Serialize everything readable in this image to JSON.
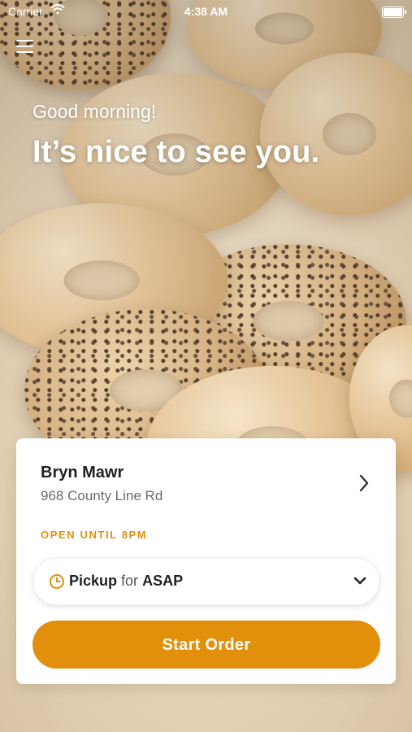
{
  "status_bar": {
    "carrier": "Carrier",
    "time": "4:38 AM"
  },
  "greeting": "Good morning!",
  "headline": "It’s nice to see you.",
  "location": {
    "name": "Bryn Mawr",
    "address": "968 County Line Rd",
    "hours": "OPEN UNTIL 8PM"
  },
  "order_mode": {
    "method": "Pickup",
    "connector": "for",
    "time": "ASAP"
  },
  "start_order_label": "Start Order",
  "colors": {
    "accent": "#e28f0b",
    "hours_text": "#e0900e"
  },
  "icons": [
    "wifi-icon",
    "battery-icon",
    "menu-icon",
    "chevron-right-icon",
    "clock-icon",
    "chevron-down-icon"
  ]
}
